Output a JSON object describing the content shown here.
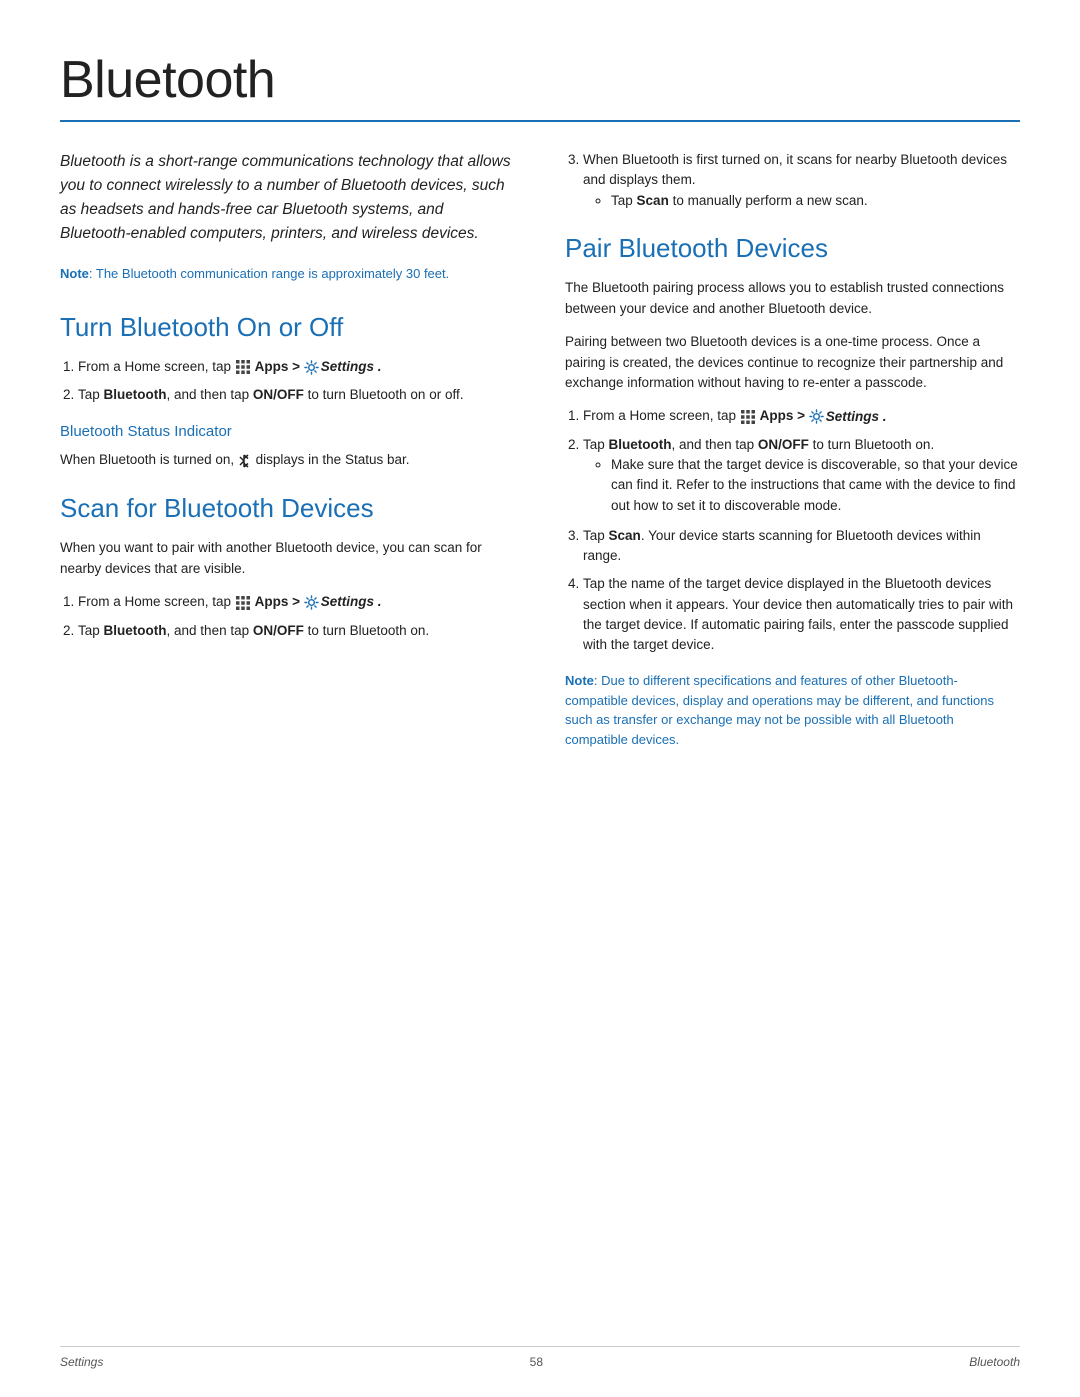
{
  "page": {
    "title": "Bluetooth",
    "footer": {
      "left": "Settings",
      "center": "58",
      "right": "Bluetooth"
    }
  },
  "intro": {
    "text": "Bluetooth is a short-range communications technology that allows you to connect wirelessly to a number of Bluetooth devices, such as headsets and hands-free car Bluetooth systems, and Bluetooth-enabled computers, printers, and wireless devices.",
    "note_label": "Note",
    "note_text": ": The Bluetooth communication range is approximately 30 feet."
  },
  "turn_section": {
    "title": "Turn Bluetooth On or Off",
    "step1_prefix": "From a Home screen, tap",
    "step1_apps": "Apps >",
    "step1_settings": "Settings",
    "step2": "Tap Bluetooth, and then tap ON/OFF to turn Bluetooth on or off.",
    "subsection_title": "Bluetooth Status Indicator",
    "sub_body": "When Bluetooth is turned on,",
    "sub_body2": "displays in the Status bar."
  },
  "scan_section": {
    "title": "Scan for Bluetooth Devices",
    "intro": "When you want to pair with another Bluetooth device, you can scan for nearby devices that are visible.",
    "step1_prefix": "From a Home screen, tap",
    "step1_apps": "Apps >",
    "step1_settings": "Settings",
    "step2": "Tap Bluetooth, and then tap ON/OFF to turn Bluetooth on.",
    "step3a": "When Bluetooth is first turned on, it scans for nearby Bluetooth devices and displays them.",
    "step3b_prefix": "Tap",
    "step3b_scan": "Scan",
    "step3b_suffix": "to manually perform a new scan."
  },
  "pair_section": {
    "title": "Pair Bluetooth Devices",
    "body1": "The Bluetooth pairing process allows you to establish trusted connections between your device and another Bluetooth device.",
    "body2": "Pairing between two Bluetooth devices is a one-time process. Once a pairing is created, the devices continue to recognize their partnership and exchange information without having to re-enter a passcode.",
    "step1_prefix": "From a Home screen, tap",
    "step1_apps": "Apps >",
    "step1_settings": "Settings",
    "step2": "Tap Bluetooth, and then tap ON/OFF to turn Bluetooth on.",
    "step2b": "Make sure that the target device is discoverable, so that your device can find it. Refer to the instructions that came with the device to find out how to set it to discoverable mode.",
    "step3_prefix": "Tap",
    "step3_scan": "Scan",
    "step3_suffix": ". Your device starts scanning for Bluetooth devices within range.",
    "step4": "Tap the name of the target device displayed in the Bluetooth devices section when it appears. Your device then automatically tries to pair with the target device. If automatic pairing fails, enter the passcode supplied with the target device.",
    "note_label": "Note",
    "note_text": ": Due to different specifications and features of other Bluetooth-compatible devices, display and operations may be different, and functions such as transfer or exchange may not be possible with all Bluetooth compatible devices."
  }
}
